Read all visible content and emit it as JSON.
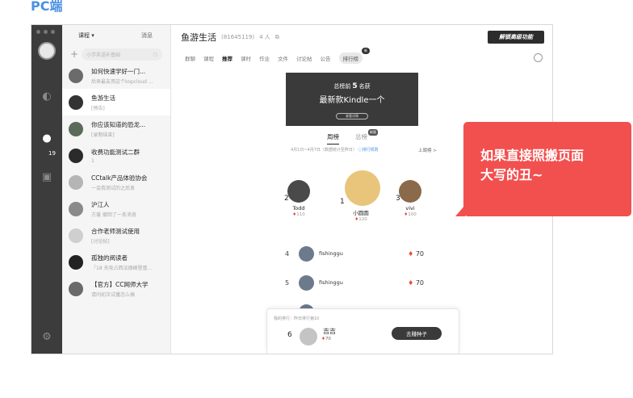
{
  "caption": "PC端",
  "list_head": {
    "course_label": "课程 ▾",
    "message_label": "消息"
  },
  "search": {
    "placeholder": "小学英语补基础"
  },
  "chats": [
    {
      "name": "如何快速学好一门...",
      "sub": "后来最友用这个kopcloud ...",
      "color": "#6b6b6b"
    },
    {
      "name": "鱼游生活",
      "sub": "[预告]",
      "color": "#333333"
    },
    {
      "name": "你应该知道的恐龙...",
      "sub": "[录制结束]",
      "color": "#5a6b5a"
    },
    {
      "name": "收费功能测试二群",
      "sub": "1",
      "color": "#2b2b2b"
    },
    {
      "name": "CCtalk产品体验协会",
      "sub": "一会我测试的之后发",
      "color": "#b5b5b5"
    },
    {
      "name": "沪江人",
      "sub": "方瑗 撤回了一条消息",
      "color": "#8a8a8a"
    },
    {
      "name": "合作老师测试使用",
      "sub": "[讨论帖]",
      "color": "#cfcfcf"
    },
    {
      "name": "孤独的阅读者",
      "sub": "「18 天攻占西法德峰登冒...",
      "color": "#222222"
    },
    {
      "name": "【官方】CC网师大学",
      "sub": "请问初次试播怎么搞",
      "color": "#6a6a6a"
    }
  ],
  "rail": {
    "badge_count": "19"
  },
  "header": {
    "title": "鱼游生活",
    "group_id": "(81645119)",
    "members": "4 人",
    "logo_text": "解锁高级功能"
  },
  "tabs": [
    "群聊",
    "课程",
    "推荐",
    "课时",
    "作业",
    "文件",
    "讨论帖",
    "公告",
    "排行榜"
  ],
  "tab_new_badge": "新",
  "banner": {
    "line1_pre": "总榜前",
    "line1_num": "5",
    "line1_post": "名获",
    "line2": "最新款Kindle一个",
    "button": "查看详情"
  },
  "rank_tabs": {
    "weekly": "周榜",
    "total": "总榜",
    "total_badge": "新版"
  },
  "rank_meta": {
    "period": "4月1日~4月7日（数据统计至昨日）",
    "rule": "ⓘ排行规则",
    "last_week": "上周榜 >"
  },
  "podium": [
    {
      "rank": "2",
      "name": "Todd",
      "points": "110",
      "color": "#4a4a4a"
    },
    {
      "rank": "1",
      "name": "小圆圆",
      "points": "120",
      "color": "#e8c57a"
    },
    {
      "rank": "3",
      "name": "vivi",
      "points": "100",
      "color": "#8a6a4a"
    }
  ],
  "rows": [
    {
      "rank": "4",
      "name": "fishinggu",
      "points": "70"
    },
    {
      "rank": "5",
      "name": "fishinggu",
      "points": "70"
    },
    {
      "rank": "6",
      "name": "吉吉",
      "points": "70"
    }
  ],
  "my_rank": {
    "label": "我的排行：昨日排行第10",
    "rank": "6",
    "name": "吉吉",
    "points": "70",
    "button": "去赚种子"
  },
  "bubble": {
    "line1": "如果直接照搬页面",
    "line2": "大写的丑~"
  }
}
